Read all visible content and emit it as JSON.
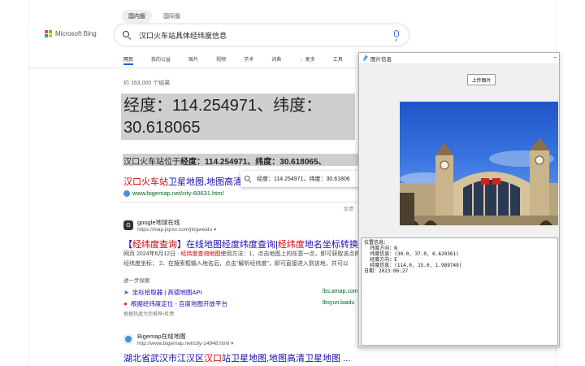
{
  "bing": {
    "region_tabs": [
      "国内版",
      "国际版"
    ],
    "logo_text": "Microsoft Bing",
    "logo_colors": [
      "#f25022",
      "#7fba00",
      "#00a4ef",
      "#ffb900"
    ],
    "search_query": "汉口火车站具体经纬度信息",
    "nav_tabs": [
      "网页",
      "我的公益",
      "图片",
      "视频",
      "学术",
      "词典",
      "⋮ 更多",
      "工具"
    ],
    "result_count": "约 163,000 个结果",
    "answer": "经度：114.254971、纬度：30.618065",
    "snippet": {
      "prefix": "汉口火车站位于",
      "bold": "经度：114.254971、纬度：30.618065、"
    },
    "result1": {
      "title_red": "汉口火车站",
      "title_rest": "卫星地图,地图高清",
      "url": "www.bigemap.net/city-60631.html"
    },
    "tooltip_text": "经度：114.254971、纬度：30.61806",
    "feedback": "反馈",
    "result2": {
      "site_name": "google地球在线",
      "site_url": "https://map.jiqrxx.com/jingweidu",
      "title_pre": "【",
      "title_red1": "经纬度查询",
      "title_mid": "】在线地图经度纬度查询|",
      "title_red2": "经纬度",
      "title_post": "地名坐标转换",
      "snippet_date": "网页 2024年6月12日 · ",
      "snippet_hl": "经纬度查询地图",
      "snippet_rest": "使用方法：1、点击地图上的任意一点，即可获取该点的经纬度坐标； 2、在搜索框输入地名后，点击\"解析经纬度\"，即可直接进入到该地，并可以"
    },
    "related": {
      "heading": "进一步探索",
      "items": [
        {
          "label": "坐标拾取器 | 高德地图API",
          "url": "lbs.amap.com"
        },
        {
          "label": "根据经纬度定位 - 百度地图开放平台",
          "url": "lbsyun.baidu"
        }
      ],
      "note": "根据热度为您推荐•反馈"
    },
    "result3": {
      "site_name": "Bigemap在线地图",
      "site_url": "http://www.bigemap.net/city-14948.html",
      "title_pre": "湖北省武汉市江汉区",
      "title_red": "汉口",
      "title_post": "站卫星地图,地图高清卫星地图 ..."
    }
  },
  "dialog": {
    "title": "图片信息",
    "upload_button": "上传图片",
    "info_lines": [
      "位置信息：",
      "  纬度方向：N",
      "  纬度信息：(30.0, 37.0, 6.620361)",
      "  经度方向：E",
      "  经度信息：(114.0, 15.0, 1.989749)",
      "日期：2023:06:27"
    ]
  }
}
